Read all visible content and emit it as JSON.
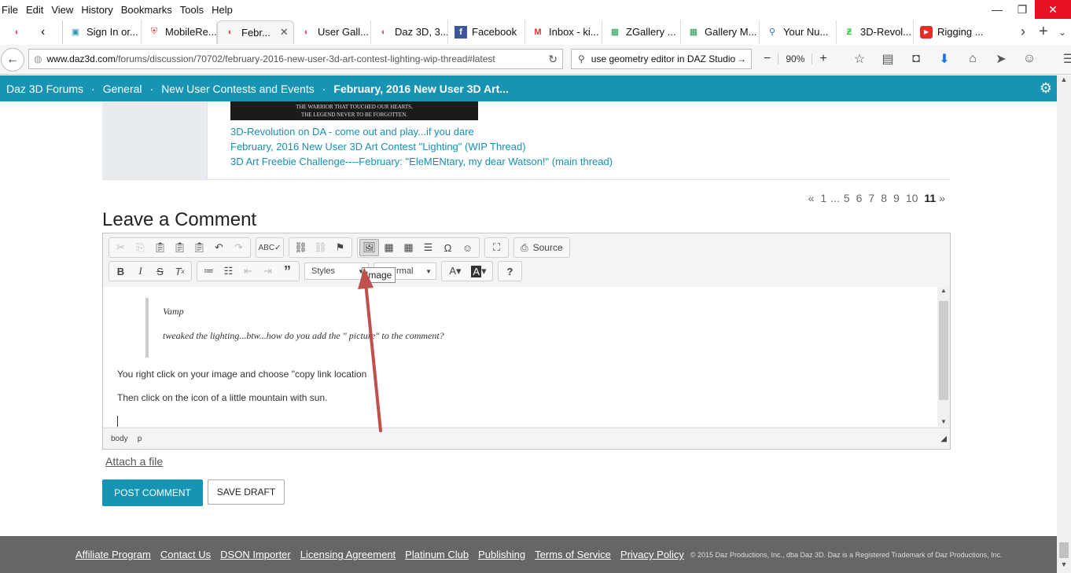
{
  "menu": [
    "File",
    "Edit",
    "View",
    "History",
    "Bookmarks",
    "Tools",
    "Help"
  ],
  "tabs": [
    {
      "label": "Sign In or...",
      "icon": "page-icon"
    },
    {
      "label": "MobileRe...",
      "icon": "shield-icon"
    },
    {
      "label": "Febr...",
      "icon": "daz-icon",
      "active": true
    },
    {
      "label": "User Gall...",
      "icon": "daz-icon"
    },
    {
      "label": "Daz 3D, 3...",
      "icon": "daz-icon"
    },
    {
      "label": "Facebook",
      "icon": "facebook-icon"
    },
    {
      "label": "Inbox - ki...",
      "icon": "gmail-icon"
    },
    {
      "label": "ZGallery ...",
      "icon": "sheets-icon"
    },
    {
      "label": "Gallery M...",
      "icon": "sheets-icon"
    },
    {
      "label": "Your Nu...",
      "icon": "page-icon"
    },
    {
      "label": "3D-Revol...",
      "icon": "deviantart-icon"
    },
    {
      "label": "Rigging ...",
      "icon": "youtube-icon"
    }
  ],
  "url": {
    "host": "www.daz3d.com",
    "path": "/forums/discussion/70702/february-2016-new-user-3d-art-contest-lighting-wip-thread#latest"
  },
  "search": {
    "value": "use geometry editor in DAZ Studio"
  },
  "zoom": "90%",
  "breadcrumb": [
    "Daz 3D Forums",
    "General",
    "New User Contests and Events",
    "February, 2016 New User 3D Art..."
  ],
  "signature": {
    "image_text": [
      "THE WARRIOR THAT TOUCHED OUR HEARTS,",
      "THE LEGEND NEVER TO BE FORGOTTEN."
    ],
    "links": [
      "3D-Revolution on DA - come out and play...if you dare",
      "February, 2016 New User 3D Art Contest \"Lighting\" (WIP Thread)",
      "3D Art Freebie Challenge----February:  \"EleMENtary, my dear Watson!\" (main thread)"
    ]
  },
  "pager": {
    "prev": "«",
    "pages": [
      "1",
      "...",
      "5",
      "6",
      "7",
      "8",
      "9",
      "10"
    ],
    "current": "11",
    "next": "»"
  },
  "leave_comment": "Leave a Comment",
  "editor": {
    "source_label": "Source",
    "styles_label": "Styles",
    "format_label": "rmal",
    "tooltip": "Image",
    "quote_name": "Vamp",
    "quote_text": "tweaked the lighting...btw...how do you add the \"     picture\" to the comment?",
    "line1": "You right click on your image and choose \"copy link location",
    "line2": "Then click on the icon of a little mountain with sun.",
    "status": [
      "body",
      "p"
    ]
  },
  "attach": "Attach a file",
  "post_comment": "POST COMMENT",
  "save_draft": "SAVE DRAFT",
  "footer": {
    "links": [
      "Affiliate Program",
      "Contact Us",
      "DSON Importer",
      "Licensing Agreement",
      "Platinum Club",
      "Publishing",
      "Terms of Service",
      "Privacy Policy"
    ],
    "copyright": "© 2015 Daz Productions, Inc., dba Daz 3D. Daz is a Registered Trademark of Daz Productions, Inc."
  },
  "colors": {
    "accent": "#1793b4",
    "link": "#1a8fb3",
    "arrow": "#c0504d"
  }
}
